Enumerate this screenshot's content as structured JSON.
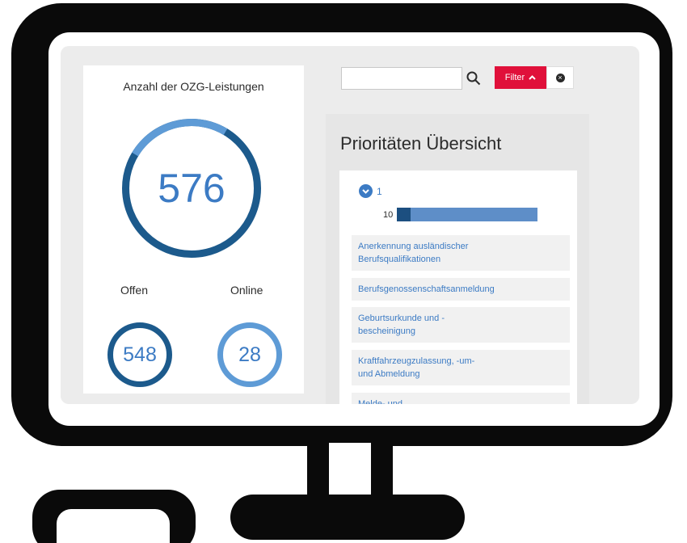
{
  "stats": {
    "title": "Anzahl der OZG-Leistungen",
    "total": "576",
    "offen_label": "Offen",
    "online_label": "Online",
    "offen_value": "548",
    "online_value": "28"
  },
  "search": {
    "value": "",
    "placeholder": ""
  },
  "filter": {
    "label": "Filter",
    "icon": "chevron-up-icon",
    "clear_icon": "close-circle-icon"
  },
  "priorities": {
    "heading": "Prioritäten Übersicht",
    "group_level": "1",
    "group_count": "10",
    "bar_fill_fraction": 0.1,
    "items": [
      {
        "label_line1": "Anerkennung ausländischer",
        "label_line2": "Berufsqualifikationen"
      },
      {
        "label_line1": "Berufsgenossenschaftsanmeldung",
        "label_line2": ""
      },
      {
        "label_line1": "Geburtsurkunde und -",
        "label_line2": "bescheinigung"
      },
      {
        "label_line1": "Kraftfahrzeugzulassung, -um-",
        "label_line2": "und Abmeldung"
      },
      {
        "label_line1": "Melde- und",
        "label_line2": ""
      }
    ]
  },
  "colors": {
    "accent": "#3c7bc4",
    "dark_blue": "#1c5a8c",
    "light_blue": "#5e9bd6",
    "filter_red": "#e0103a"
  }
}
